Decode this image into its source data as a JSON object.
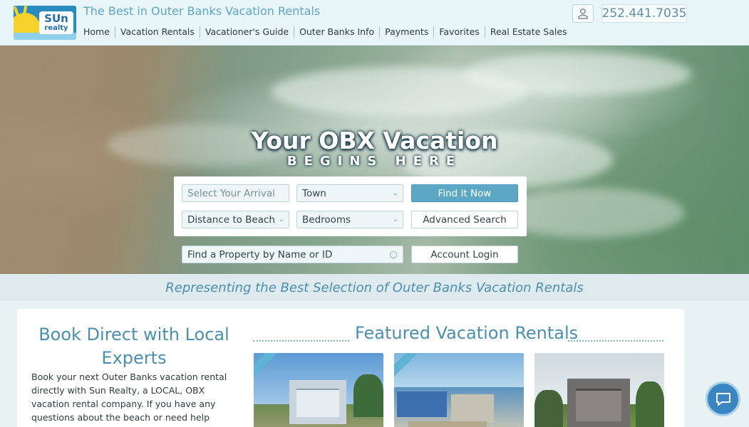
{
  "header": {
    "logo": {
      "line1": "SUn",
      "line2": "realty"
    },
    "tagline": "The Best in Outer Banks Vacation Rentals",
    "nav": [
      "Home",
      "Vacation Rentals",
      "Vacationer's Guide",
      "Outer Banks Info",
      "Payments",
      "Favorites",
      "Real Estate Sales"
    ],
    "user_icon": "user-icon",
    "phone": "252.441.7035"
  },
  "hero": {
    "title": "Your OBX Vacation",
    "subtitle": "BEGINS HERE",
    "search": {
      "arrival_placeholder": "Select Your Arrival",
      "town_value": "Town",
      "distance_value": "Distance to Beach",
      "bedrooms_value": "Bedrooms",
      "find_button": "Find It Now",
      "advanced_button": "Advanced Search",
      "property_placeholder": "Find a Property by Name or ID",
      "login_button": "Account Login"
    }
  },
  "strip": {
    "text": "Representing the Best Selection of Outer Banks Vacation Rentals"
  },
  "book": {
    "title": "Book Direct with Local Experts",
    "text": "Book your next Outer Banks vacation rental directly with Sun Realty, a LOCAL, OBX vacation rental company. If you have any questions about the beach or need help selecting the best area or"
  },
  "featured": {
    "title": "Featured Vacation Rentals"
  },
  "chat": {
    "icon": "chat-icon"
  },
  "colors": {
    "accent": "#4b8fb0",
    "button": "#5ba7c4",
    "header_bg": "#e8f5f9"
  }
}
